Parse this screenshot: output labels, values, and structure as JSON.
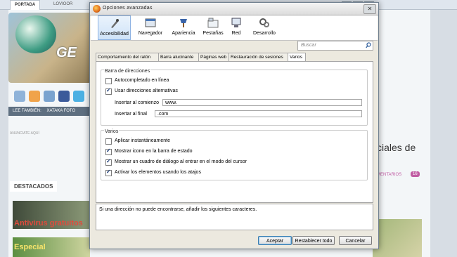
{
  "background": {
    "tabs": [
      "PORTADA",
      "LOVIOOR"
    ],
    "nav_items": [
      "LEE TAMBIÉN:",
      "XATAKA FOTO"
    ],
    "small_text": "ANUNCIATE AQUÍ",
    "destacados": "DESTACADOS",
    "thumb1_text": "Antivirus gratuitos",
    "thumb2_text": "Especial",
    "headline_fragment": "ciales de",
    "comments_label": "MENTARIOS",
    "comments_count": "16",
    "logo_text": "GE",
    "window_controls": [
      "–",
      "▫",
      "✕"
    ]
  },
  "dialog": {
    "title": "Opciones avanzadas",
    "close_glyph": "✕",
    "toolbar": [
      {
        "label": "Accesibilidad",
        "icon": "accessibility-icon",
        "selected": true
      },
      {
        "label": "Navegador",
        "icon": "browser-icon",
        "selected": false
      },
      {
        "label": "Apariencia",
        "icon": "appearance-icon",
        "selected": false
      },
      {
        "label": "Pestañas",
        "icon": "tabs-icon",
        "selected": false
      },
      {
        "label": "Red",
        "icon": "network-icon",
        "selected": false
      },
      {
        "label": "Desarrollo",
        "icon": "development-icon",
        "selected": false
      }
    ],
    "search_placeholder": "Buscar",
    "subtabs": [
      {
        "label": "Comportamiento del ratón",
        "active": false
      },
      {
        "label": "Barra alucinante",
        "active": false
      },
      {
        "label": "Páginas web",
        "active": false
      },
      {
        "label": "Restauración de sesiones",
        "active": false
      },
      {
        "label": "Varios",
        "active": true
      }
    ],
    "address_group": {
      "title": "Barra de direcciones",
      "options": [
        {
          "label": "Autocompletado en línea",
          "checked": false
        },
        {
          "label": "Usar direcciones alternativas",
          "checked": true
        }
      ],
      "insert_start_label": "Insertar al comienzo",
      "insert_start_value": "www.",
      "insert_end_label": "Insertar al final",
      "insert_end_value": ".com"
    },
    "misc_group": {
      "title": "Varios",
      "options": [
        {
          "label": "Aplicar instantáneamente",
          "checked": false
        },
        {
          "label": "Mostrar icono en la barra de estado",
          "checked": true
        },
        {
          "label": "Mostrar un cuadro de diálogo al entrar en el modo del cursor",
          "checked": true
        },
        {
          "label": "Activar los elementos usando los atajos",
          "checked": true
        }
      ]
    },
    "info_text": "Si una dirección no puede encontrarse, añadir los siguientes caracteres.",
    "buttons": {
      "accept": "Aceptar",
      "reset": "Restablecer todo",
      "cancel": "Cancelar"
    },
    "colors": {
      "selected_tab": "#cfe3f8",
      "dialog_bg": "#ece9df",
      "accent": "#3c7fb1"
    }
  }
}
